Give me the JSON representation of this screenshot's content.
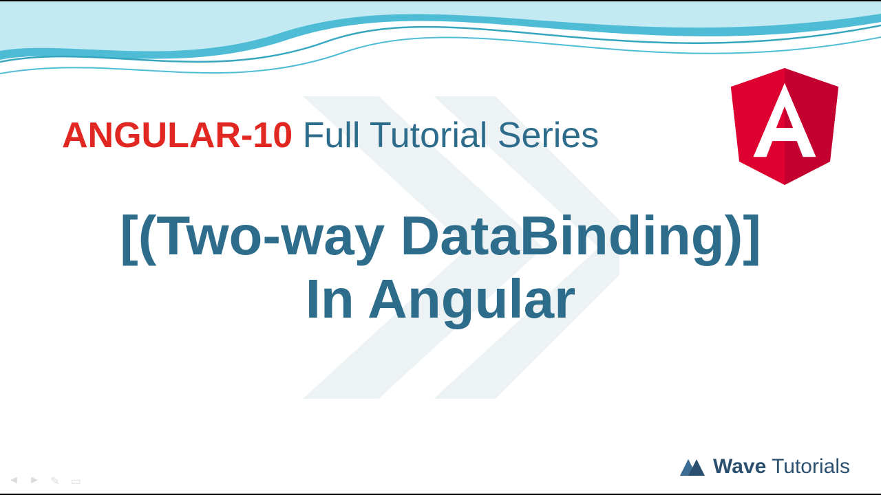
{
  "series": {
    "brand_red": "ANGULAR-10",
    "tagline": "Full Tutorial Series"
  },
  "title": "[(Two-way DataBinding)]\nIn Angular",
  "brand": {
    "name_bold": "Wave",
    "name_light": " Tutorials"
  },
  "icons": {
    "angular": "angular-shield-icon",
    "brand_mark": "wave-tutorials-mark-icon"
  },
  "colors": {
    "accent_blue": "#2d6c8a",
    "accent_red": "#e12722",
    "wave_teal": "#4fbcd6"
  }
}
